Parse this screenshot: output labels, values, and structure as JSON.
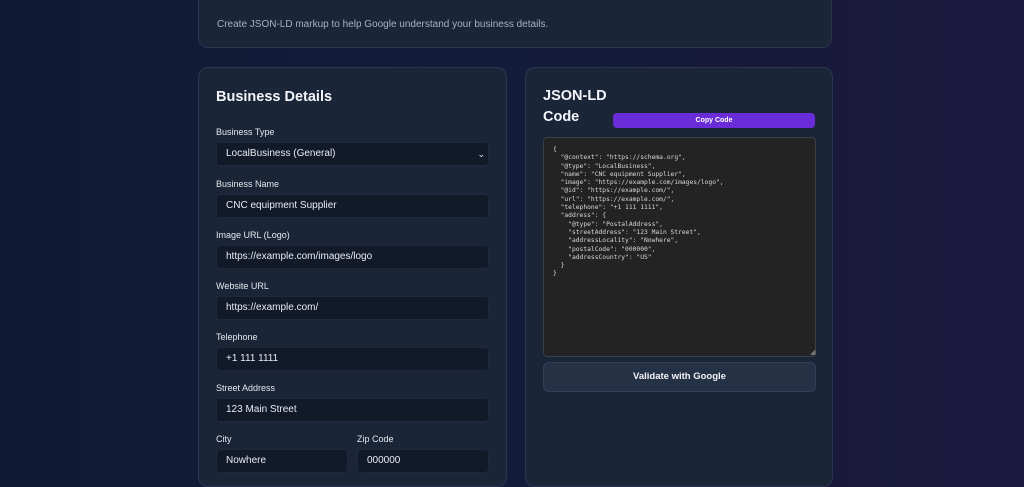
{
  "header": {
    "subtitle": "Create JSON-LD markup to help Google understand your business details."
  },
  "form": {
    "title": "Business Details",
    "business_type": {
      "label": "Business Type",
      "value": "LocalBusiness (General)"
    },
    "business_name": {
      "label": "Business Name",
      "value": "CNC equipment Supplier"
    },
    "image_url": {
      "label": "Image URL (Logo)",
      "value": "https://example.com/images/logo"
    },
    "website_url": {
      "label": "Website URL",
      "value": "https://example.com/"
    },
    "telephone": {
      "label": "Telephone",
      "value": "+1 111 1111"
    },
    "street_address": {
      "label": "Street Address",
      "value": "123 Main Street"
    },
    "city": {
      "label": "City",
      "value": "Nowhere"
    },
    "zip_code": {
      "label": "Zip Code",
      "value": "000000"
    }
  },
  "output": {
    "title_line1": "JSON-LD",
    "title_line2": "Code",
    "copy_label": "Copy Code",
    "code": "{\n  \"@context\": \"https://schema.org\",\n  \"@type\": \"LocalBusiness\",\n  \"name\": \"CNC equipment Supplier\",\n  \"image\": \"https://example.com/images/logo\",\n  \"@id\": \"https://example.com/\",\n  \"url\": \"https://example.com/\",\n  \"telephone\": \"+1 111 1111\",\n  \"address\": {\n    \"@type\": \"PostalAddress\",\n    \"streetAddress\": \"123 Main Street\",\n    \"addressLocality\": \"Nowhere\",\n    \"postalCode\": \"000000\",\n    \"addressCountry\": \"US\"\n  }\n}",
    "validate_label": "Validate with Google"
  },
  "icons": {
    "select_chevron": "chevron-down-icon",
    "resize_grip": "resize-handle-icon"
  },
  "colors": {
    "accent": "#6a2bd8",
    "panel": "#1a2538",
    "input": "#121a2a"
  }
}
